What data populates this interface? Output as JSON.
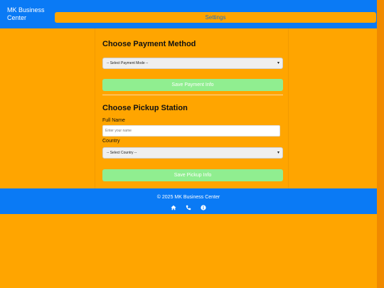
{
  "header": {
    "brand": "MK Business Center",
    "settings_label": "Settings"
  },
  "payment": {
    "title": "Choose Payment Method",
    "select_value": "-- Select Payment Mode --",
    "save_label": "Save Payment Info"
  },
  "pickup": {
    "title": "Choose Pickup Station",
    "full_name_label": "Full Name",
    "full_name_placeholder": "Enter your name",
    "country_label": "Country",
    "country_value": "-- Select Country --",
    "save_label": "Save Pickup Info"
  },
  "footer": {
    "copyright": "© 2025 MK Business Center",
    "icons": [
      "home-icon",
      "phone-icon",
      "info-icon"
    ]
  },
  "colors": {
    "page_bg": "#ffa500",
    "header_bg": "#0a7af5",
    "button_green": "#90ee90"
  }
}
